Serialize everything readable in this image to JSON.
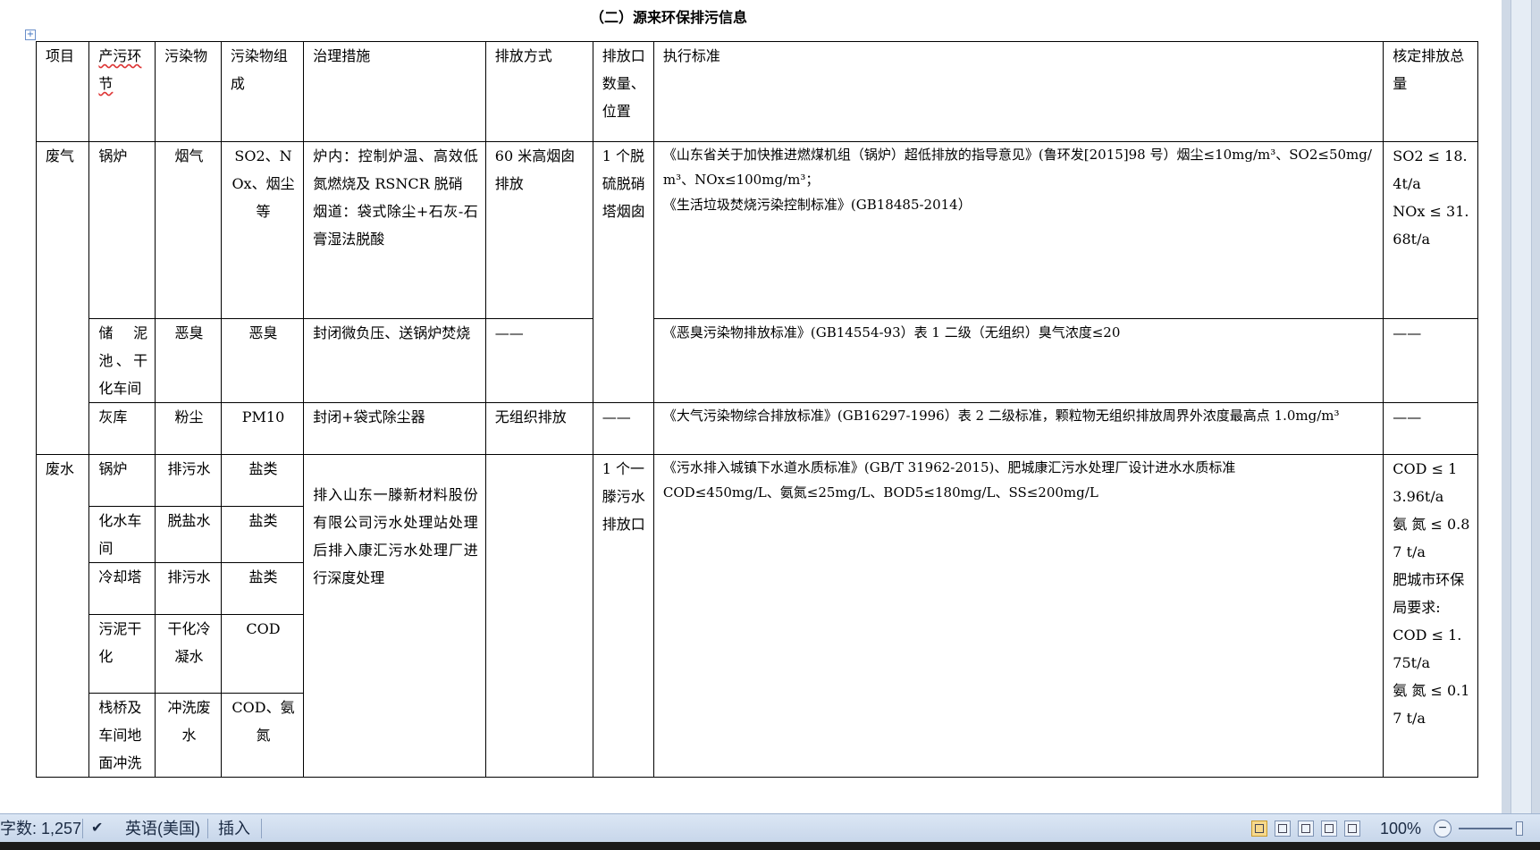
{
  "document": {
    "title": "（二）源来环保排污信息",
    "table": {
      "headers": [
        "项目",
        "产污环节",
        "污染物",
        "污染物组成",
        "治理措施",
        "排放方式",
        "排放口数量、位置",
        "执行标准",
        "核定排放总量"
      ],
      "gas": {
        "category": "废气",
        "boiler": {
          "stage": "锅炉",
          "pollutant": "烟气",
          "composition": "SO2、NOx、烟尘等",
          "measure_1": "炉内：控制炉温、高效低氮燃烧及 RSNCR 脱硝",
          "measure_2": "烟道：袋式除尘+石灰-石膏湿法脱酸",
          "discharge": "60 米高烟囱排放",
          "outlet": "1 个脱硫脱硝塔烟囱",
          "standard_1": "《山东省关于加快推进燃煤机组（锅炉）超低排放的指导意见》(鲁环发[2015]98 号）烟尘≤10mg/m³、SO2≤50mg/m³、NOx≤100mg/m³；",
          "standard_2": "《生活垃圾焚烧污染控制标准》(GB18485-2014）",
          "total_1": "SO2 ≤ 18.4t/a",
          "total_2": "NOx ≤ 31.68t/a"
        },
        "sludge": {
          "stage": "储泥池、干化车间",
          "pollutant": "恶臭",
          "composition": "恶臭",
          "measure": "封闭微负压、送锅炉焚烧",
          "discharge": "——",
          "standard": "《恶臭污染物排放标准》(GB14554-93）表 1 二级（无组织）臭气浓度≤20",
          "total": "——"
        },
        "ash": {
          "stage": "灰库",
          "pollutant": "粉尘",
          "composition": "PM10",
          "measure": "封闭+袋式除尘器",
          "discharge": "无组织排放",
          "outlet": "——",
          "standard": "《大气污染物综合排放标准》(GB16297-1996）表 2 二级标准，颗粒物无组织排放周界外浓度最高点 1.0mg/m³",
          "total": "——"
        }
      },
      "water": {
        "category": "废水",
        "rows": [
          {
            "stage": "锅炉",
            "pollutant": "排污水",
            "composition": "盐类"
          },
          {
            "stage": "化水车间",
            "pollutant": "脱盐水",
            "composition": "盐类"
          },
          {
            "stage": "冷却塔",
            "pollutant": "排污水",
            "composition": "盐类"
          },
          {
            "stage": "污泥干化",
            "pollutant": "干化冷凝水",
            "composition": "COD"
          },
          {
            "stage": "栈桥及车间地面冲洗",
            "pollutant": "冲洗废水",
            "composition": "COD、氨氮"
          }
        ],
        "measure": "排入山东一滕新材料股份有限公司污水处理站处理后排入康汇污水处理厂进行深度处理",
        "outlet": "1 个一滕污水排放口",
        "standard_1": "《污水排入城镇下水道水质标准》(GB/T 31962-2015)、肥城康汇污水处理厂设计进水水质标准",
        "standard_2": "COD≤450mg/L、氨氮≤25mg/L、BOD5≤180mg/L、SS≤200mg/L",
        "total_1": "COD ≤ 13.96t/a",
        "total_2": "氨 氮 ≤ 0.87 t/a",
        "total_3": "肥城市环保局要求:",
        "total_4": "COD ≤ 1.75t/a",
        "total_5": "氨 氮 ≤ 0.17 t/a"
      }
    }
  },
  "statusbar": {
    "word_count": "字数: 1,257",
    "language": "英语(美国)",
    "mode": "插入",
    "zoom": "100%"
  }
}
